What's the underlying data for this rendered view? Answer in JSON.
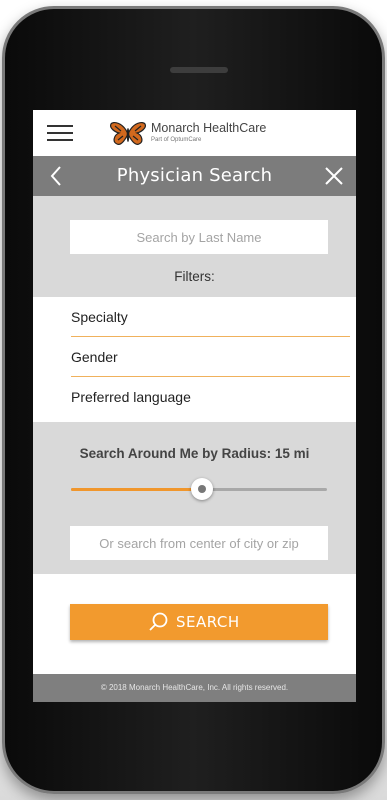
{
  "brand": {
    "name": "Monarch HealthCare",
    "sub": "Part of OptumCare"
  },
  "header": {
    "title": "Physician Search"
  },
  "search": {
    "last_name_placeholder": "Search by Last Name",
    "filters_label": "Filters:"
  },
  "filters": [
    {
      "label": "Specialty"
    },
    {
      "label": "Gender"
    },
    {
      "label": "Preferred language"
    }
  ],
  "radius": {
    "label": "Search Around Me by Radius: 15 mi",
    "slider_fraction": 0.51,
    "city_zip_placeholder": "Or search from center of city or zip"
  },
  "actions": {
    "search_label": "SEARCH"
  },
  "footer": {
    "text": "© 2018 Monarch HealthCare, Inc. All rights reserved."
  },
  "colors": {
    "accent": "#f29a2e",
    "titlebar": "#7c7c7c",
    "panel": "#d9d9d9"
  },
  "icons": [
    "menu-icon",
    "butterfly-logo",
    "back-icon",
    "close-icon",
    "search-icon"
  ]
}
